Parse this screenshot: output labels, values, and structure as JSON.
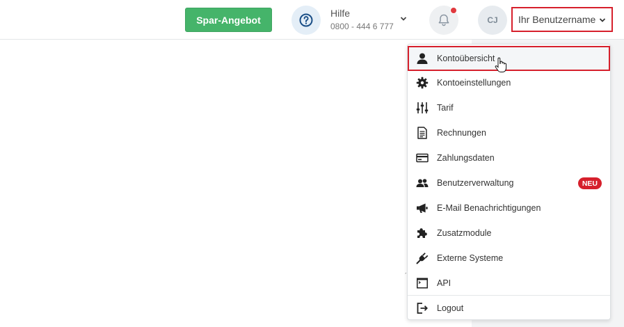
{
  "header": {
    "offer_button": "Spar-Angebot",
    "help": {
      "title": "Hilfe",
      "phone": "0800 - 444 6 777"
    },
    "avatar_initials": "CJ",
    "username": "Ihr Benutzername"
  },
  "menu": {
    "items": [
      {
        "label": "Kontoübersicht",
        "icon": "user-icon"
      },
      {
        "label": "Kontoeinstellungen",
        "icon": "gear-icon"
      },
      {
        "label": "Tarif",
        "icon": "sliders-icon"
      },
      {
        "label": "Rechnungen",
        "icon": "document-icon"
      },
      {
        "label": "Zahlungsdaten",
        "icon": "credit-card-icon"
      },
      {
        "label": "Benutzerverwaltung",
        "icon": "users-icon",
        "badge": "NEU"
      },
      {
        "label": "E-Mail Benachrichtigungen",
        "icon": "megaphone-icon"
      },
      {
        "label": "Zusatzmodule",
        "icon": "puzzle-icon"
      },
      {
        "label": "Externe Systeme",
        "icon": "plug-icon"
      },
      {
        "label": "API",
        "icon": "terminal-icon"
      },
      {
        "label": "Logout",
        "icon": "logout-icon"
      }
    ]
  },
  "colors": {
    "offer_green": "#45b46a",
    "highlight_red": "#d6202c",
    "notification_dot": "#e0393e",
    "help_bg": "#e4eef7"
  }
}
